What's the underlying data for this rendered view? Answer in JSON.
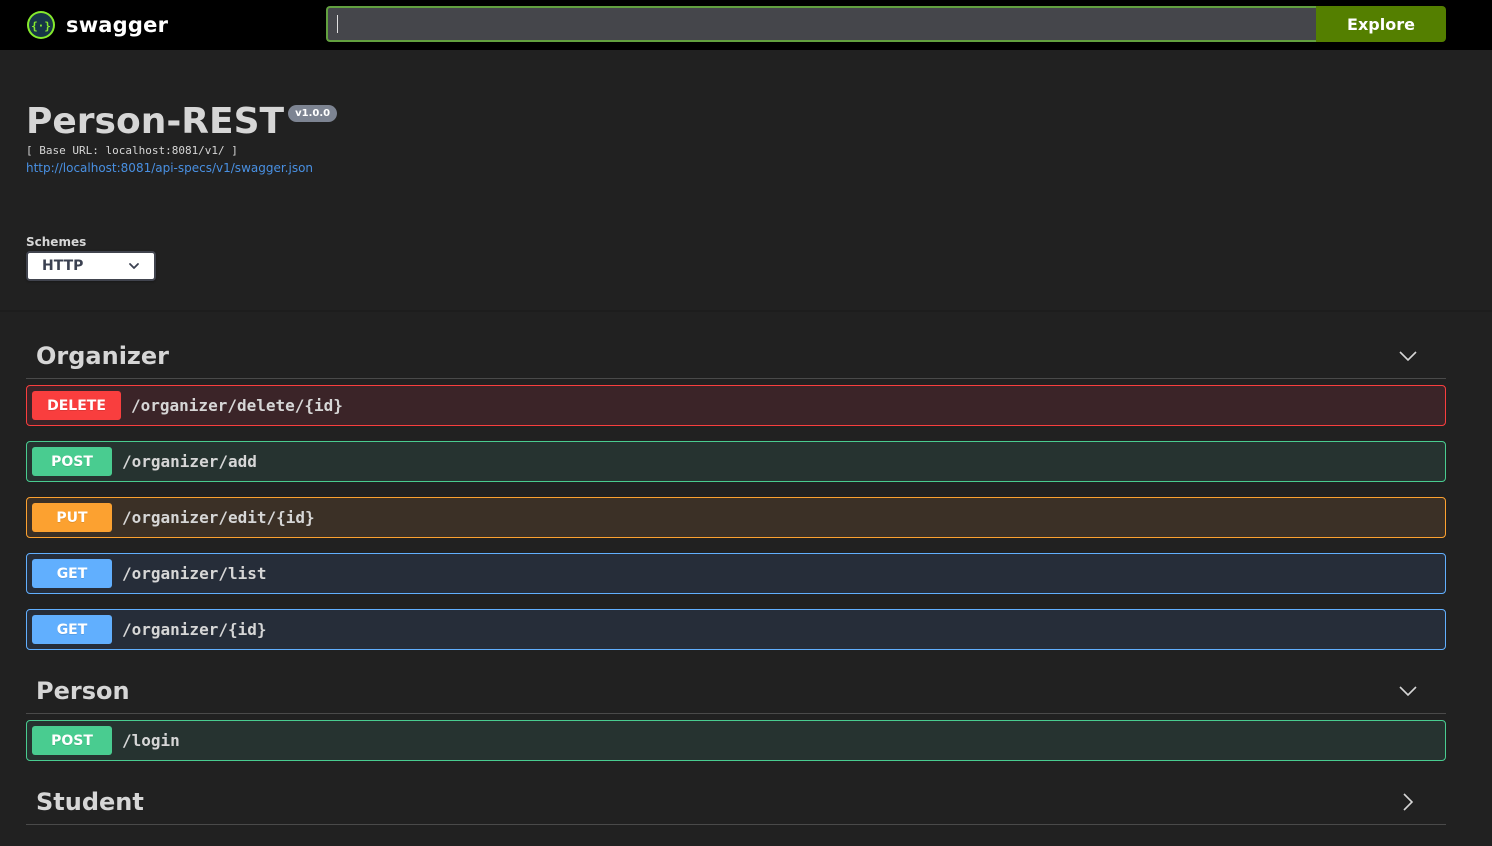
{
  "topbar": {
    "brand": "swagger",
    "search_value": "",
    "explore_label": "Explore"
  },
  "info": {
    "title": "Person-REST",
    "version": "v1.0.0",
    "base_url": "[ Base URL: localhost:8081/v1/ ]",
    "spec_link": "http://localhost:8081/api-specs/v1/swagger.json"
  },
  "schemes": {
    "label": "Schemes",
    "selected": "HTTP"
  },
  "tags": [
    {
      "name": "Organizer",
      "expanded": true,
      "operations": [
        {
          "method": "DELETE",
          "path": "/organizer/delete/{id}"
        },
        {
          "method": "POST",
          "path": "/organizer/add"
        },
        {
          "method": "PUT",
          "path": "/organizer/edit/{id}"
        },
        {
          "method": "GET",
          "path": "/organizer/list"
        },
        {
          "method": "GET",
          "path": "/organizer/{id}"
        }
      ]
    },
    {
      "name": "Person",
      "expanded": true,
      "operations": [
        {
          "method": "POST",
          "path": "/login"
        }
      ]
    },
    {
      "name": "Student",
      "expanded": false,
      "operations": []
    }
  ],
  "colors": {
    "delete": "#f93e3e",
    "post": "#49cc90",
    "put": "#fca130",
    "get": "#61affe",
    "explore": "#547f00",
    "link": "#4990e2"
  },
  "icons": {
    "logo": "swagger-logo-icon",
    "expanded": "chevron-down-icon",
    "collapsed": "chevron-right-icon",
    "select": "chevron-down-icon"
  }
}
